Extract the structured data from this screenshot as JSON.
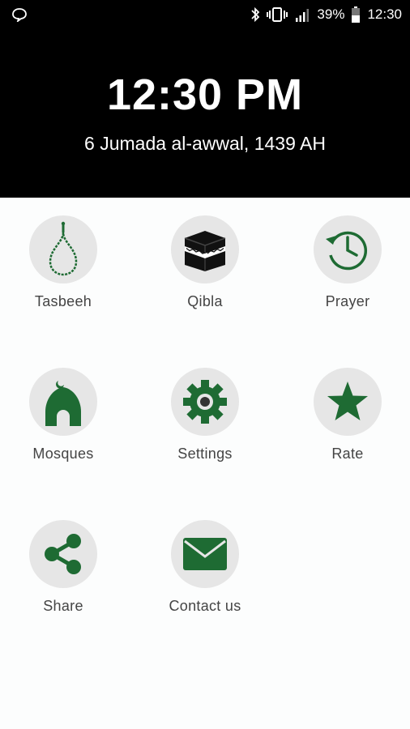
{
  "status_bar": {
    "battery": "39%",
    "time": "12:30",
    "icons": [
      "chat-bubble-icon",
      "bluetooth-icon",
      "vibrate-icon",
      "signal-icon",
      "battery-icon"
    ]
  },
  "header": {
    "time": "12:30 PM",
    "hijri_date": "6 Jumada al-awwal, 1439 AH"
  },
  "colors": {
    "icon_green": "#1e6b33",
    "circle_bg": "#e6e6e6",
    "header_bg": "#000000"
  },
  "menu": [
    {
      "label": "Tasbeeh",
      "icon": "prayer-beads-icon"
    },
    {
      "label": "Qibla",
      "icon": "kaaba-icon"
    },
    {
      "label": "Prayer",
      "icon": "clock-history-icon"
    },
    {
      "label": "Mosques",
      "icon": "mosque-icon"
    },
    {
      "label": "Settings",
      "icon": "gear-icon"
    },
    {
      "label": "Rate",
      "icon": "star-icon"
    },
    {
      "label": "Share",
      "icon": "share-icon"
    },
    {
      "label": "Contact us",
      "icon": "envelope-icon"
    }
  ]
}
